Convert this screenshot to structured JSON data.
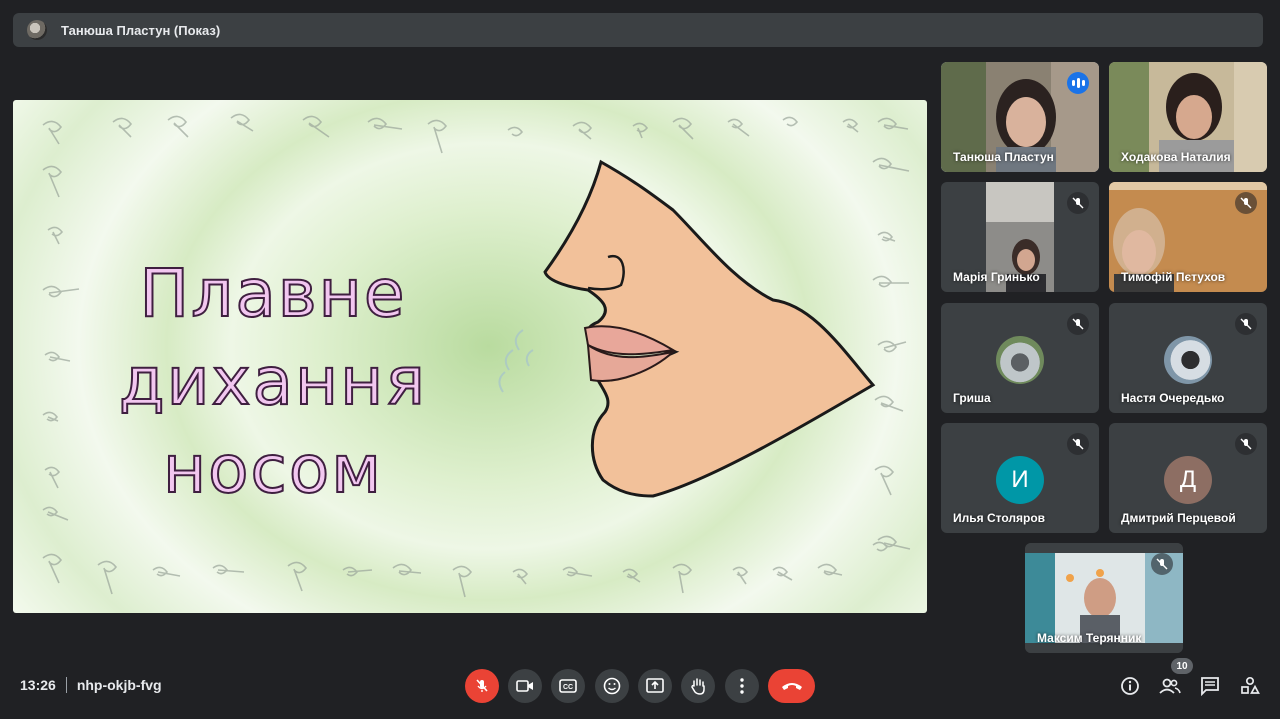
{
  "presenter_bar": {
    "title": "Танюша Пластун (Показ)"
  },
  "slide": {
    "lines": [
      "Плавне",
      "дихання",
      "носом"
    ]
  },
  "participants": [
    {
      "name": "Танюша Пластун",
      "state": "speaking"
    },
    {
      "name": "Ходакова Наталия",
      "state": "video"
    },
    {
      "name": "Марія Гринько",
      "state": "muted"
    },
    {
      "name": "Тимофій Пєтухов",
      "state": "muted"
    },
    {
      "name": "Гриша",
      "state": "muted"
    },
    {
      "name": "Настя Очередько",
      "state": "muted"
    },
    {
      "name": "Илья Столяров",
      "initial": "И",
      "color": "#0097a7",
      "state": "muted"
    },
    {
      "name": "Дмитрий Перцевой",
      "initial": "Д",
      "color": "#8d6e63",
      "state": "muted"
    },
    {
      "name": "Максим Терянник",
      "state": "muted"
    }
  ],
  "meeting": {
    "time": "13:26",
    "code": "nhp-okjb-fvg"
  },
  "controls": [
    {
      "icon": "mic-off-icon"
    },
    {
      "icon": "camera-icon"
    },
    {
      "icon": "captions-icon"
    },
    {
      "icon": "emoji-icon"
    },
    {
      "icon": "present-icon"
    },
    {
      "icon": "raise-hand-icon"
    },
    {
      "icon": "more-options-icon"
    },
    {
      "icon": "end-call-icon"
    }
  ],
  "right_controls": {
    "participants_count": "10",
    "icons": [
      "info-icon",
      "people-icon",
      "chat-icon",
      "activities-icon"
    ]
  },
  "colors": {
    "background": "#202124",
    "accent": "#8ab4f8",
    "danger": "#ea4335"
  }
}
